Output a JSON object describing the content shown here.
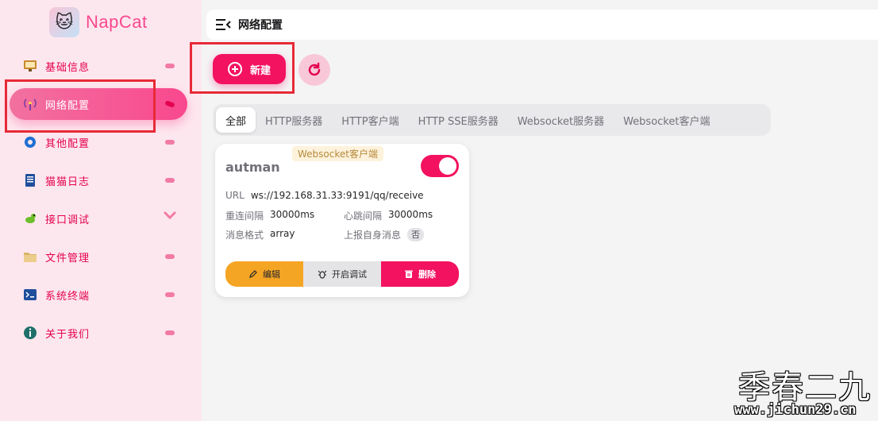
{
  "app": {
    "name": "NapCat"
  },
  "sidebar": {
    "items": [
      {
        "label": "基础信息",
        "icon": "dashboard-icon"
      },
      {
        "label": "网络配置",
        "icon": "antenna-icon",
        "active": true
      },
      {
        "label": "其他配置",
        "icon": "gear-icon"
      },
      {
        "label": "猫猫日志",
        "icon": "log-book-icon"
      },
      {
        "label": "接口调试",
        "icon": "bug-icon"
      },
      {
        "label": "文件管理",
        "icon": "folder-icon"
      },
      {
        "label": "系统终端",
        "icon": "terminal-icon"
      },
      {
        "label": "关于我们",
        "icon": "info-icon"
      }
    ]
  },
  "topbar": {
    "title": "网络配置"
  },
  "toolbar": {
    "new_label": "新建"
  },
  "tabs": [
    "全部",
    "HTTP服务器",
    "HTTP客户端",
    "HTTP SSE服务器",
    "Websocket服务器",
    "Websocket客户端"
  ],
  "card": {
    "type_chip": "Websocket客户端",
    "name": "autman",
    "enabled": true,
    "url_label": "URL",
    "url": "ws://192.168.31.33:9191/qq/receive",
    "reconnect_label": "重连间隔",
    "reconnect": "30000ms",
    "heartbeat_label": "心跳间隔",
    "heartbeat": "30000ms",
    "format_label": "消息格式",
    "format": "array",
    "report_self_label": "上报自身消息",
    "report_self": "否",
    "edit_label": "编辑",
    "debug_label": "开启调试",
    "delete_label": "删除"
  },
  "watermark": {
    "title": "季春二九",
    "url": "www.jichun29.cn"
  },
  "colors": {
    "primary": "#f31260",
    "warning": "#f5a524",
    "highlight": "#e72a36",
    "sidebar_bg": "#fde7ee"
  }
}
